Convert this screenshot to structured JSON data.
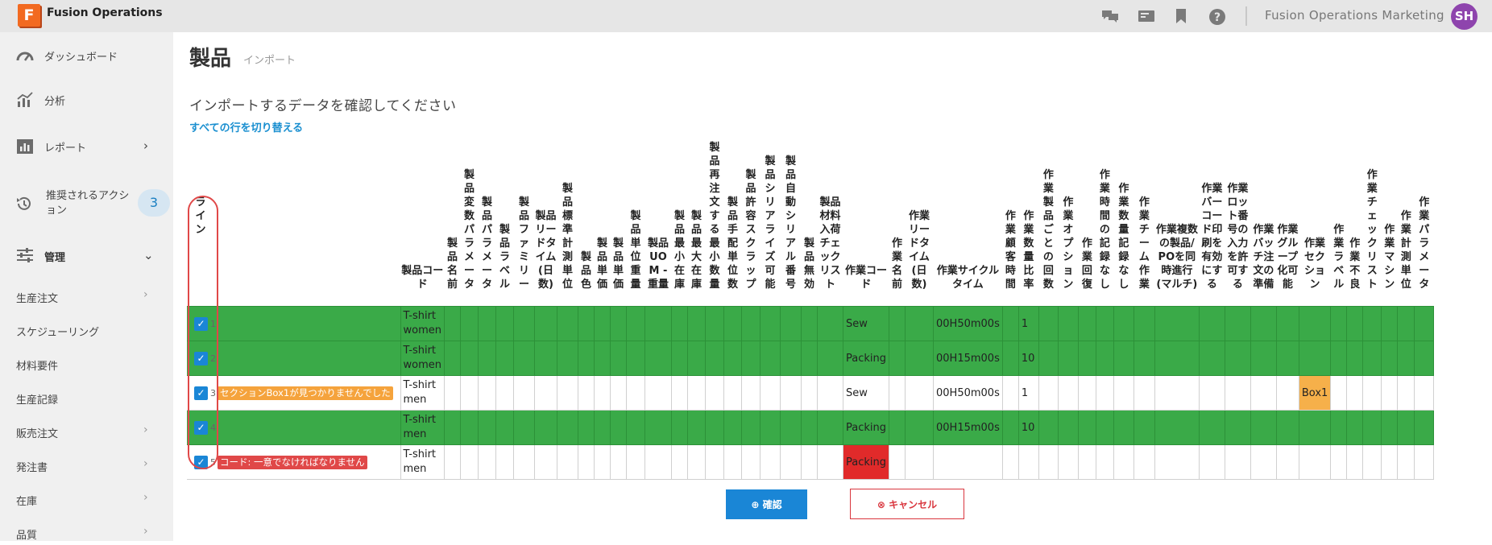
{
  "app": {
    "logo_letter": "F",
    "title": "Fusion Operations",
    "org_name": "Fusion Operations Marketing",
    "user_initials": "SH"
  },
  "topbar_icons": [
    "chat-icon",
    "announcement-icon",
    "bookmark-icon",
    "help-icon"
  ],
  "sidebar": {
    "main_items": [
      {
        "label": "ダッシュボード",
        "icon": "dashboard-icon"
      },
      {
        "label": "分析",
        "icon": "analytics-icon"
      },
      {
        "label": "レポート",
        "icon": "report-icon"
      },
      {
        "label": "推奨されるアクション",
        "icon": "history-icon",
        "badge": "3"
      },
      {
        "label": "管理",
        "icon": "sliders-icon"
      }
    ],
    "sub_items": [
      "生産注文",
      "スケジューリング",
      "材料要件",
      "生産記録",
      "販売注文",
      "発注書",
      "在庫",
      "品質"
    ]
  },
  "page": {
    "title": "製品",
    "subtitle": "インポート",
    "heading": "インポートするデータを確認してください",
    "toggle_link": "すべての行を切り替える"
  },
  "columns": [
    "ライン",
    "製品コード",
    "製品名前",
    "製品変数パラメータ",
    "製品パラメータ",
    "製品ラベル",
    "製品ファミリー",
    "製品リードタイム(日数)",
    "製品標準計測単位",
    "製品色",
    "製品単価",
    "製品単価",
    "製品単位重量",
    "製品UOM - 重量",
    "製品最小在庫",
    "製品最大在庫",
    "製品再注文する最小数量",
    "製品手配単位数",
    "製品許容スクラップ",
    "製品シリアライズ可能",
    "製品自動シリアル番号",
    "製品無効",
    "製品材料入荷チェックリスト",
    "作業コード",
    "作業名前",
    "作業リードタイム(日数)",
    "作業サイクルタイム",
    "作業顧客時間",
    "作業数量比率",
    "作業製品ごとの回数",
    "作業オプション",
    "作業回復",
    "作業時間の記録なし",
    "作業数量記録なし",
    "作業チーム作業",
    "作業複数の製品/POを同時進行(マルチ)",
    "作業バーコード印刷を有効にする",
    "作業ロット番号の入力を許可する",
    "作業バッチ注文の準備",
    "作業グループ化可能",
    "作業セクション",
    "作業ラベル",
    "作業不良",
    "作業チェックリスト",
    "作業マシン",
    "作業計測単位",
    "作業パラメータ"
  ],
  "rows": [
    {
      "num": "1",
      "status": "ok",
      "error": "",
      "product_code": "T-shirt women",
      "op_code": "Sew",
      "cycle_time": "00H50m00s",
      "qty_ratio": "1",
      "section": ""
    },
    {
      "num": "2",
      "status": "ok",
      "error": "",
      "product_code": "T-shirt women",
      "op_code": "Packing",
      "cycle_time": "00H15m00s",
      "qty_ratio": "10",
      "section": ""
    },
    {
      "num": "3",
      "status": "warn",
      "error": "セクションBox1が見つかりませんでした",
      "product_code": "T-shirt men",
      "op_code": "Sew",
      "cycle_time": "00H50m00s",
      "qty_ratio": "1",
      "section": "Box1"
    },
    {
      "num": "4",
      "status": "ok",
      "error": "",
      "product_code": "T-shirt men",
      "op_code": "Packing",
      "cycle_time": "00H15m00s",
      "qty_ratio": "10",
      "section": ""
    },
    {
      "num": "5",
      "status": "error",
      "error": "コード: 一意でなければなりません",
      "product_code": "T-shirt men",
      "op_code": "Packing",
      "cycle_time": "",
      "qty_ratio": "",
      "section": ""
    }
  ],
  "buttons": {
    "confirm": "⊕ 確認",
    "cancel": "⊗ キャンセル"
  },
  "colors": {
    "ok_row": "#3aaa48",
    "warn_tag": "#f5a33c",
    "error_tag": "#e04848",
    "accent": "#1a86d6",
    "brand": "#f26a21"
  }
}
